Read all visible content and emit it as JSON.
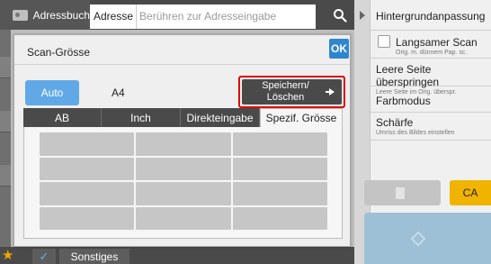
{
  "topbar": {
    "addressbook_label": "Adressbuch",
    "address_label": "Adresse",
    "address_placeholder": "Berühren zur Adresseingabe"
  },
  "right_panel": {
    "items": [
      {
        "title": "Hintergrundanpassung",
        "sub": ""
      },
      {
        "title": "Langsamer Scan",
        "sub": "Orig. m. dünnem Pap. sc."
      },
      {
        "title": "Leere Seite überspringen",
        "sub": "Leere Seite im Orig. überspr."
      },
      {
        "title": "Farbmodus",
        "sub": ""
      },
      {
        "title": "Schärfe",
        "sub": "Umriss des Bildes einstellen"
      }
    ],
    "ca_label": "CA"
  },
  "bottom": {
    "other_label": "Sonstiges"
  },
  "dialog": {
    "title": "Scan-Grösse",
    "ok_label": "OK",
    "auto_label": "Auto",
    "size_value": "A4",
    "save_delete_label": "Speichern/ Löschen",
    "tabs": [
      {
        "label": "AB",
        "active": false
      },
      {
        "label": "Inch",
        "active": false
      },
      {
        "label": "Direkteingabe",
        "active": false
      },
      {
        "label": "Spezif. Grösse",
        "active": true
      }
    ]
  },
  "colors": {
    "accent_blue": "#61a9e6",
    "ok_blue": "#2f86d0",
    "ca_yellow": "#f0b400",
    "highlight_red": "#e00000",
    "dark_bar": "#4a4a4a"
  }
}
